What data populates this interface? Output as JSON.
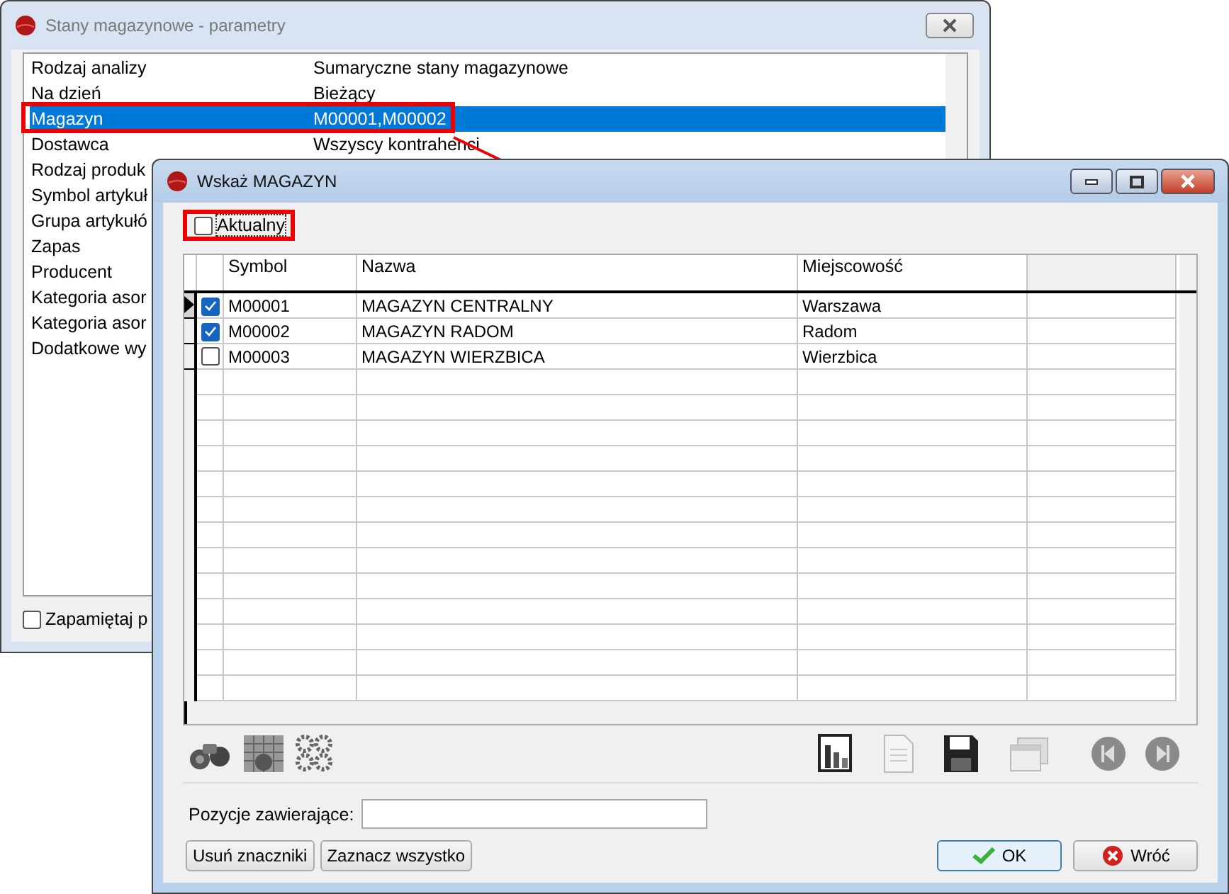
{
  "back_window": {
    "title": "Stany magazynowe - parametry",
    "rows": [
      {
        "label": "Rodzaj analizy",
        "value": "Sumaryczne stany magazynowe",
        "selected": false
      },
      {
        "label": "Na dzień",
        "value": "Bieżący",
        "selected": false
      },
      {
        "label": "Magazyn",
        "value": "M00001,M00002",
        "selected": true
      },
      {
        "label": "Dostawca",
        "value": "Wszyscy kontrahenci",
        "selected": false
      },
      {
        "label": "Rodzaj produk",
        "selected": false
      },
      {
        "label": "Symbol artykuł",
        "selected": false
      },
      {
        "label": "Grupa artykułó",
        "selected": false
      },
      {
        "label": "Zapas",
        "selected": false
      },
      {
        "label": "Producent",
        "selected": false
      },
      {
        "label": "Kategoria asor",
        "selected": false
      },
      {
        "label": "Kategoria asor",
        "selected": false
      },
      {
        "label": "Dodatkowe wy",
        "selected": false
      }
    ],
    "remember": {
      "label": "Zapamiętaj p",
      "checked": false
    }
  },
  "dialog": {
    "title": "Wskaż MAGAZYN",
    "current_only": {
      "label": "Aktualny",
      "checked": false
    },
    "columns": [
      "Symbol",
      "Nazwa",
      "Miejscowość"
    ],
    "rows": [
      {
        "symbol": "M00001",
        "nazwa": "MAGAZYN CENTRALNY",
        "miejscowosc": "Warszawa",
        "checked": true,
        "current": true
      },
      {
        "symbol": "M00002",
        "nazwa": "MAGAZYN RADOM",
        "miejscowosc": "Radom",
        "checked": true,
        "current": false
      },
      {
        "symbol": "M00003",
        "nazwa": "MAGAZYN WIERZBICA",
        "miejscowosc": "Wierzbica",
        "checked": false,
        "current": false
      }
    ],
    "filter_label": "Pozycje zawierające:",
    "left_buttons": [
      "Usuń znaczniki",
      "Zaznacz wszystko"
    ],
    "ok": "OK",
    "back": "Wróć"
  }
}
